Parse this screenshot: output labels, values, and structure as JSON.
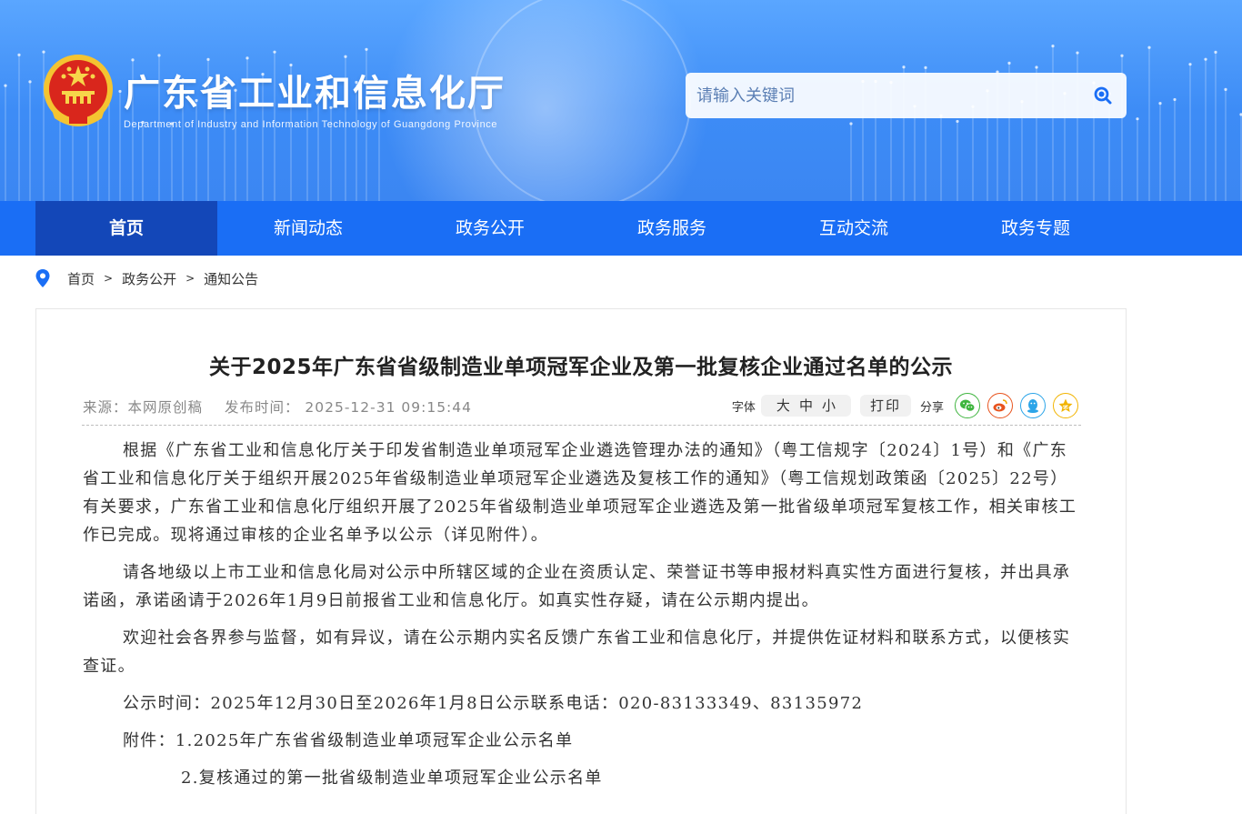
{
  "header": {
    "title": "广东省工业和信息化厅",
    "subtitle": "Department of Industry and Information Technology of Guangdong Province",
    "search_placeholder": "请输入关键词"
  },
  "nav": {
    "items": [
      "首页",
      "新闻动态",
      "政务公开",
      "政务服务",
      "互动交流",
      "政务专题"
    ],
    "active": "首页"
  },
  "breadcrumb": {
    "items": [
      "首页",
      "政务公开",
      "通知公告"
    ],
    "separator": ">"
  },
  "article": {
    "title": "关于2025年广东省省级制造业单项冠军企业及第一批复核企业通过名单的公示",
    "source": "来源：本网原创稿",
    "publish_time": "发布时间： 2025-12-31 09:15:44",
    "tools": {
      "font_label": "字体",
      "font_sizes": [
        "大",
        "中",
        "小"
      ],
      "print": "打印",
      "share_label": "分享",
      "share_icons": [
        "wechat-icon",
        "weibo-icon",
        "qq-icon",
        "qzone-icon"
      ]
    },
    "paragraphs": [
      "根据《广东省工业和信息化厅关于印发省制造业单项冠军企业遴选管理办法的通知》（粤工信规字〔2024〕1号）和《广东省工业和信息化厅关于组织开展2025年省级制造业单项冠军企业遴选及复核工作的通知》（粤工信规划政策函〔2025〕22号）有关要求，广东省工业和信息化厅组织开展了2025年省级制造业单项冠军企业遴选及第一批省级单项冠军复核工作，相关审核工作已完成。现将通过审核的企业名单予以公示（详见附件）。",
      "请各地级以上市工业和信息化局对公示中所辖区域的企业在资质认定、荣誉证书等申报材料真实性方面进行复核，并出具承诺函，承诺函请于2026年1月9日前报省工业和信息化厅。如真实性存疑，请在公示期内提出。",
      "欢迎社会各界参与监督，如有异议，请在公示期内实名反馈广东省工业和信息化厅，并提供佐证材料和联系方式，以便核实查证。",
      "公示时间：2025年12月30日至2026年1月8日公示联系电话：020-83133349、83135972",
      "附件：1.2025年广东省省级制造业单项冠军企业公示名单",
      "2.复核通过的第一批省级制造业单项冠军企业公示名单"
    ]
  },
  "colors": {
    "banner": "#3d8cf6",
    "nav": "#1a6ef5",
    "nav_active": "#1347b8",
    "wechat": "#3fb53f",
    "weibo": "#e8541e",
    "qq": "#2aa4e8",
    "qzone": "#f2b400"
  }
}
